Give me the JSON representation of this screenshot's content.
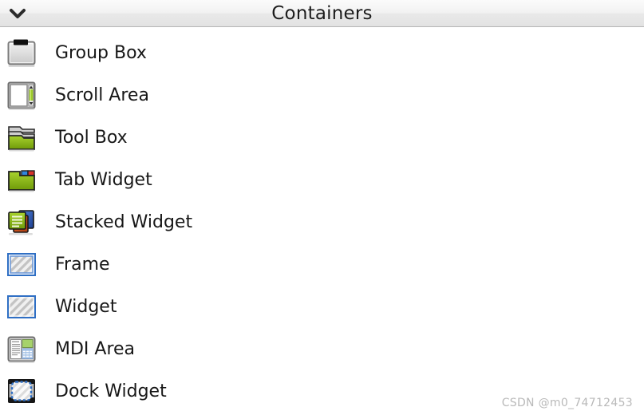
{
  "header": {
    "title": "Containers",
    "collapse_icon": "chevron-down-icon"
  },
  "list": {
    "items": [
      {
        "label": "Group Box",
        "icon": "group-box-icon"
      },
      {
        "label": "Scroll Area",
        "icon": "scroll-area-icon"
      },
      {
        "label": "Tool Box",
        "icon": "tool-box-icon"
      },
      {
        "label": "Tab Widget",
        "icon": "tab-widget-icon"
      },
      {
        "label": "Stacked Widget",
        "icon": "stacked-widget-icon"
      },
      {
        "label": "Frame",
        "icon": "frame-icon"
      },
      {
        "label": "Widget",
        "icon": "widget-icon"
      },
      {
        "label": "MDI Area",
        "icon": "mdi-area-icon"
      },
      {
        "label": "Dock Widget",
        "icon": "dock-widget-icon"
      }
    ]
  },
  "watermark": {
    "text": "CSDN @m0_74712453"
  },
  "colors": {
    "background": "#ffffff",
    "header_top": "#fbfbfb",
    "header_bottom": "#e2e2e2",
    "header_border": "#b6b6b6",
    "text": "#171717",
    "accent_green": "#8cc01e",
    "accent_blue": "#3b7fd4",
    "accent_orange": "#d6521e",
    "watermark": "#b9b9b9"
  }
}
